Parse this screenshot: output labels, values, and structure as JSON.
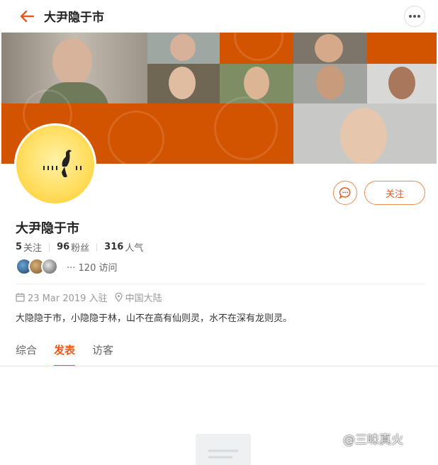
{
  "header": {
    "title": "大尹隐于市",
    "back_icon": "arrow-left-icon",
    "more_icon": "more-dots-icon"
  },
  "profile": {
    "name": "大尹隐于市",
    "following_count": "5",
    "following_label": "关注",
    "fans_count": "96",
    "fans_label": "粉丝",
    "popularity_count": "316",
    "popularity_label": "人气",
    "visits_text": "··· 120 访问",
    "joined": "23 Mar 2019 入驻",
    "location": "中国大陆",
    "bio": "大隐隐于市，小隐隐于林，山不在高有仙则灵，水不在深有龙则灵。"
  },
  "actions": {
    "follow_label": "关注",
    "message_icon": "chat-bubble-icon"
  },
  "tabs": [
    {
      "label": "综合",
      "active": false
    },
    {
      "label": "发表",
      "active": true
    },
    {
      "label": "访客",
      "active": false
    }
  ],
  "watermark": "@三味真火",
  "colors": {
    "accent": "#e85a1a",
    "banner_orange": "#d35400",
    "avatar_yellow": "#ffd84e"
  }
}
